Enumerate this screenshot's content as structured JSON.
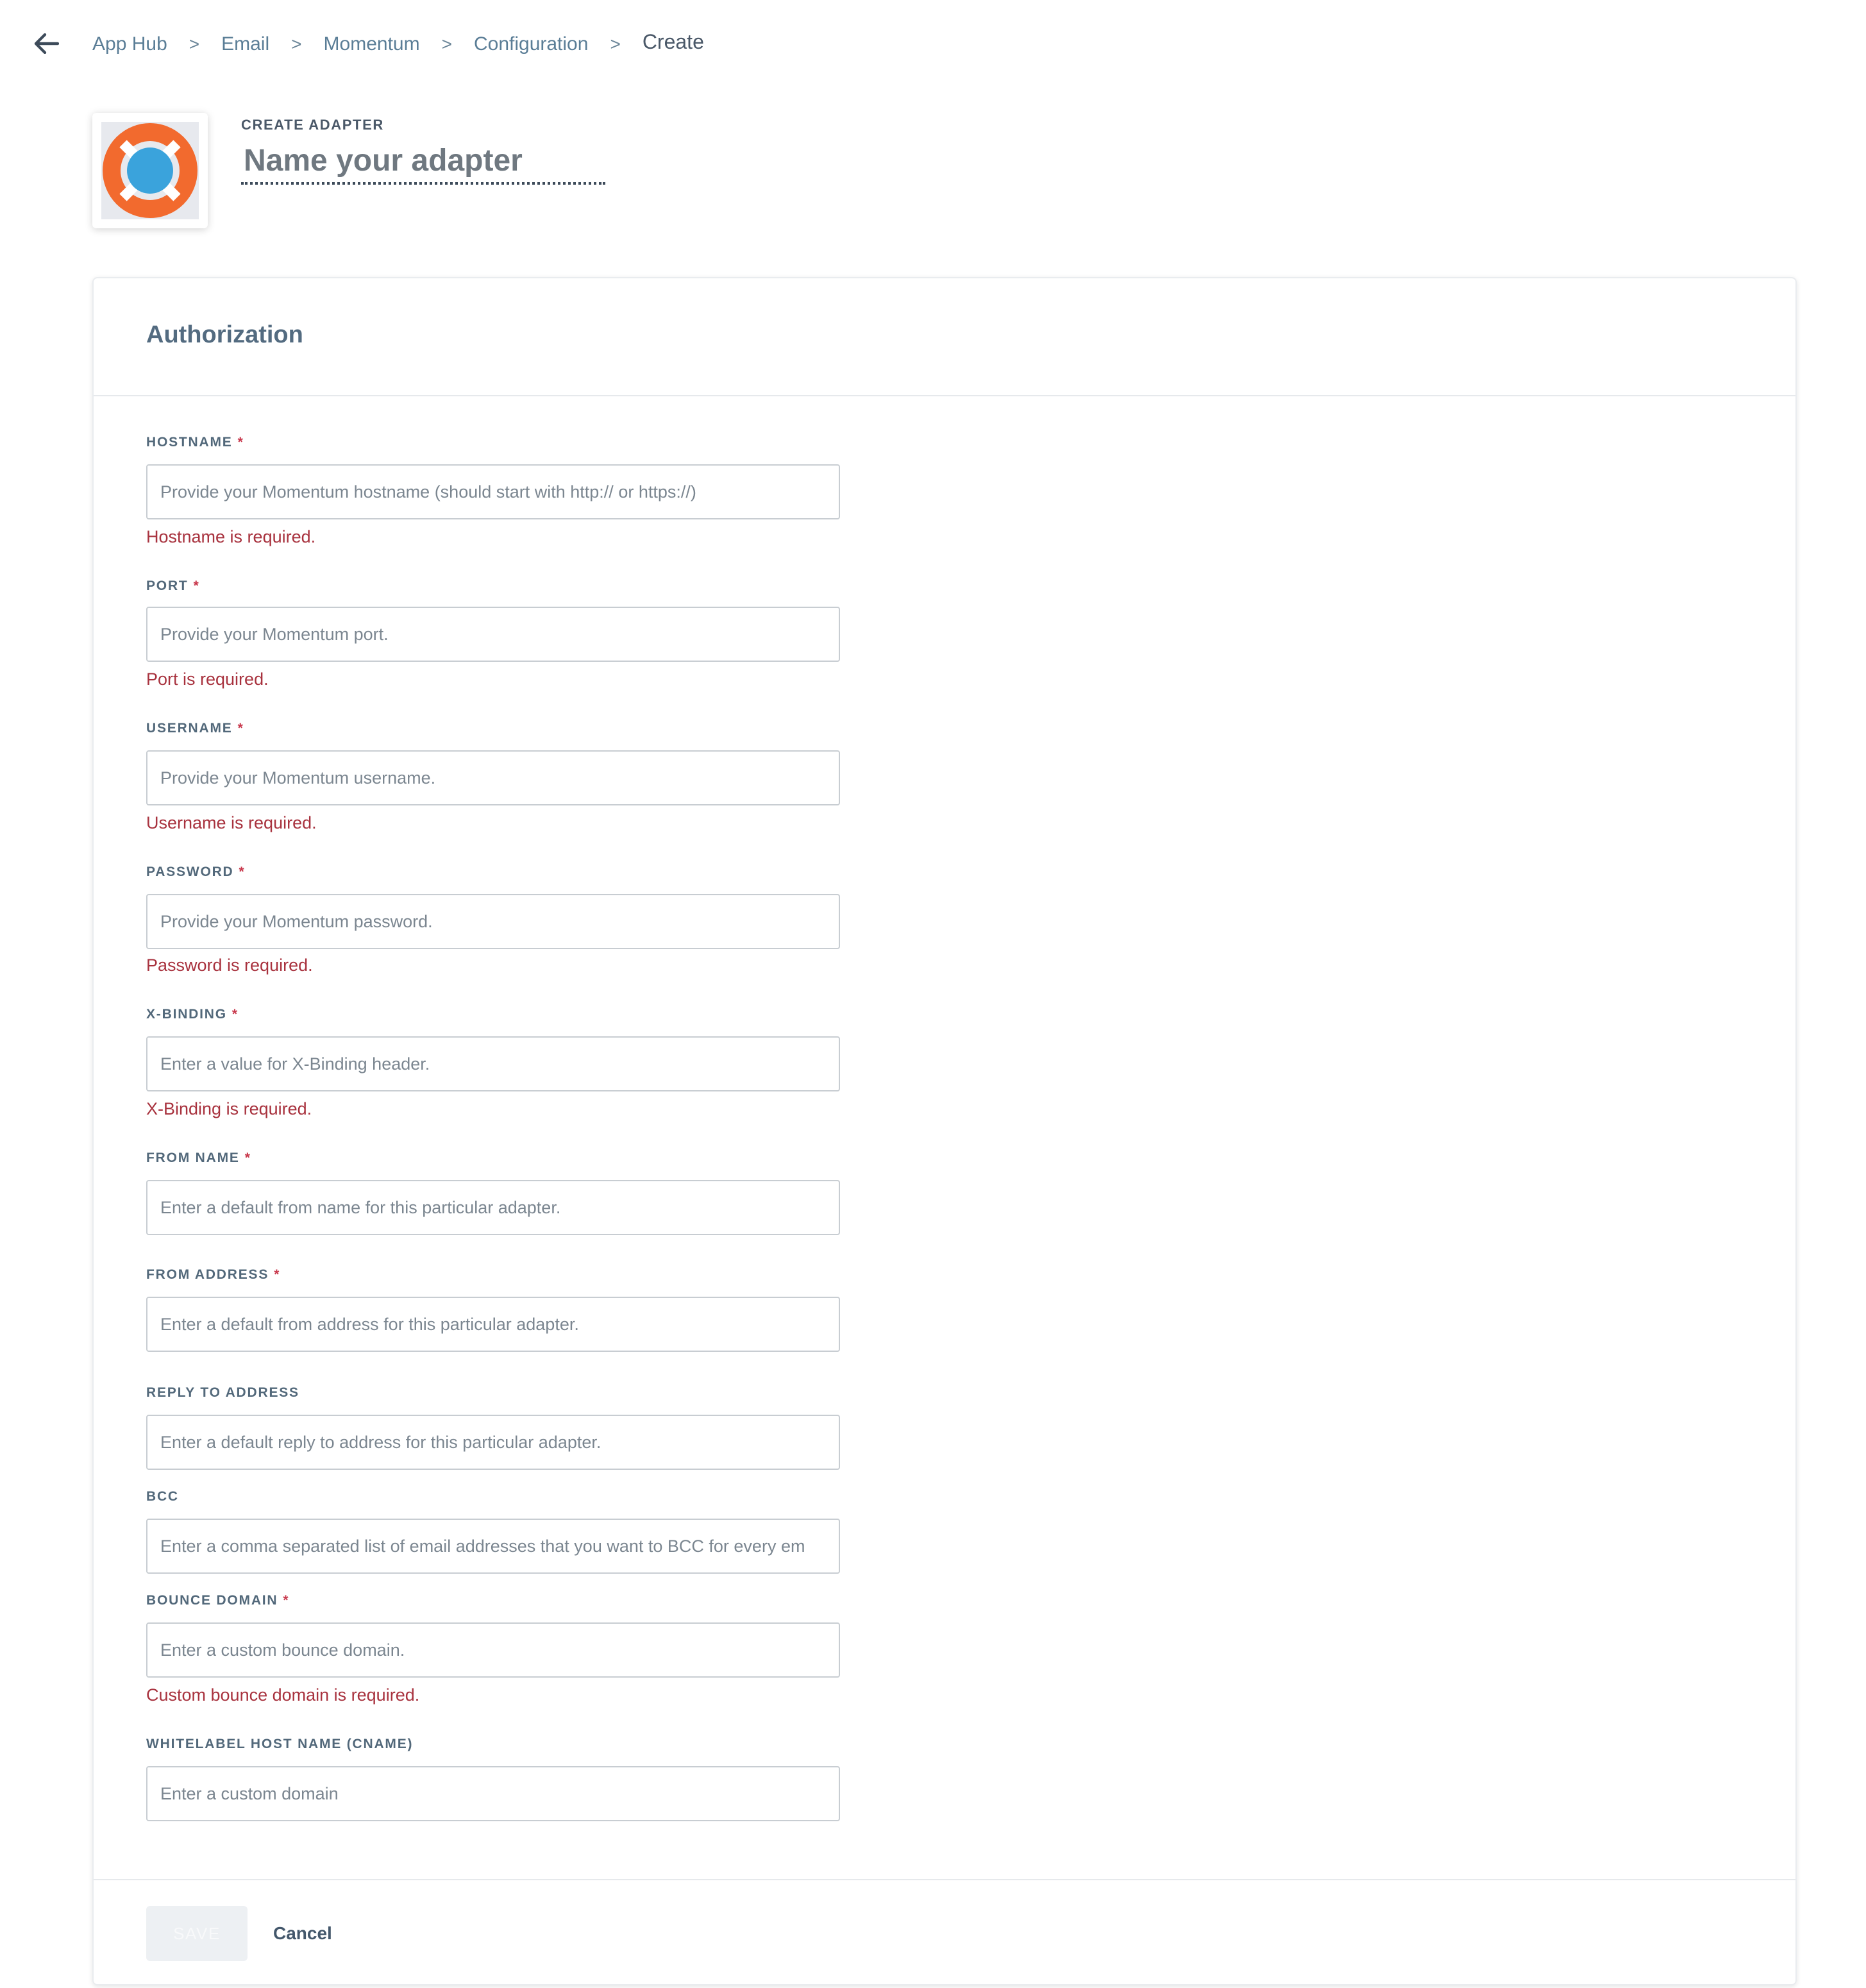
{
  "breadcrumb": {
    "items": [
      {
        "label": "App Hub"
      },
      {
        "label": "Email"
      },
      {
        "label": "Momentum"
      },
      {
        "label": "Configuration"
      },
      {
        "label": "Create"
      }
    ],
    "separator": ">"
  },
  "header": {
    "eyebrow": "CREATE ADAPTER",
    "name_placeholder": "Name your adapter",
    "logo_icon": "lifebuoy-icon"
  },
  "card": {
    "title": "Authorization"
  },
  "fields": [
    {
      "label": "HOSTNAME",
      "required": "*",
      "placeholder": "Provide your Momentum hostname (should start with http:// or https://)",
      "value": "",
      "error": "Hostname is required."
    },
    {
      "label": "PORT",
      "required": "*",
      "placeholder": "Provide your Momentum port.",
      "value": "",
      "error": "Port is required."
    },
    {
      "label": "USERNAME",
      "required": "*",
      "placeholder": "Provide your Momentum username.",
      "value": "",
      "error": "Username is required."
    },
    {
      "label": "PASSWORD",
      "required": "*",
      "placeholder": "Provide your Momentum password.",
      "value": "",
      "error": "Password is required."
    },
    {
      "label": "X-BINDING",
      "required": "*",
      "placeholder": "Enter a value for X-Binding header.",
      "value": "",
      "error": "X-Binding is required."
    },
    {
      "label": "FROM NAME",
      "required": "*",
      "placeholder": "Enter a default from name for this particular adapter.",
      "value": ""
    },
    {
      "label": "FROM ADDRESS",
      "required": "*",
      "placeholder": "Enter a default from address for this particular adapter.",
      "value": ""
    },
    {
      "label": "REPLY TO ADDRESS",
      "placeholder": "Enter a default reply to address for this particular adapter.",
      "value": ""
    },
    {
      "label": "BCC",
      "placeholder": "Enter a comma separated list of email addresses that you want to BCC for every em",
      "value": ""
    },
    {
      "label": "BOUNCE DOMAIN",
      "required": "*",
      "placeholder": "Enter a custom bounce domain.",
      "value": "",
      "error": "Custom bounce domain is required."
    },
    {
      "label": "WHITELABEL HOST NAME (CNAME)",
      "placeholder": "Enter a custom domain",
      "value": ""
    }
  ],
  "footer": {
    "save_label": "SAVE",
    "cancel_label": "Cancel"
  },
  "colors": {
    "error": "#a8323e",
    "required": "#c8374b",
    "label": "#52687a",
    "logo_ring": "#f26a2e",
    "logo_center": "#3aa3dc"
  }
}
